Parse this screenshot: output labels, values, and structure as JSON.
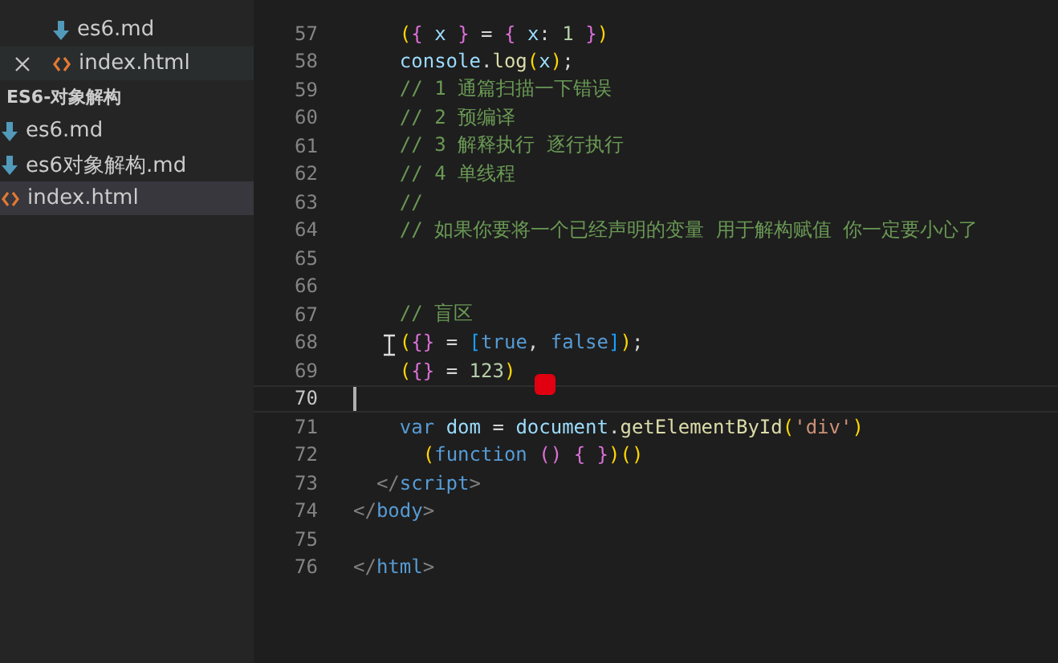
{
  "sidebar": {
    "open_editors": [
      {
        "name": "es6.md",
        "kind": "md",
        "hovered": false,
        "selected": false
      },
      {
        "name": "index.html",
        "kind": "html",
        "hovered": true,
        "selected": false
      }
    ],
    "folder": {
      "title": "ES6-对象解构",
      "items": [
        {
          "name": "es6.md",
          "kind": "md",
          "selected": false
        },
        {
          "name": "es6对象解构.md",
          "kind": "md",
          "selected": false
        },
        {
          "name": "index.html",
          "kind": "html",
          "selected": true
        }
      ]
    }
  },
  "editor": {
    "lines": [
      {
        "number": "57",
        "current": false,
        "tokens": [
          {
            "text": "    (",
            "kind": "b1"
          },
          {
            "text": "{",
            "kind": "b2"
          },
          {
            "text": " x ",
            "kind": "var"
          },
          {
            "text": "}",
            "kind": "b2"
          },
          {
            "text": " = ",
            "kind": "plain"
          },
          {
            "text": "{",
            "kind": "b2"
          },
          {
            "text": " x",
            "kind": "var"
          },
          {
            "text": ": ",
            "kind": "plain"
          },
          {
            "text": "1 ",
            "kind": "num"
          },
          {
            "text": "}",
            "kind": "b2"
          },
          {
            "text": ")",
            "kind": "b1"
          }
        ]
      },
      {
        "number": "58",
        "current": false,
        "tokens": [
          {
            "text": "    console",
            "kind": "var"
          },
          {
            "text": ".",
            "kind": "plain"
          },
          {
            "text": "log",
            "kind": "fn"
          },
          {
            "text": "(",
            "kind": "b1"
          },
          {
            "text": "x",
            "kind": "var"
          },
          {
            "text": ")",
            "kind": "b1"
          },
          {
            "text": ";",
            "kind": "plain"
          }
        ]
      },
      {
        "number": "59",
        "current": false,
        "tokens": [
          {
            "text": "    // 1 通篇扫描一下错误",
            "kind": "comment"
          }
        ]
      },
      {
        "number": "60",
        "current": false,
        "tokens": [
          {
            "text": "    // 2 预编译",
            "kind": "comment"
          }
        ]
      },
      {
        "number": "61",
        "current": false,
        "tokens": [
          {
            "text": "    // 3 解释执行 逐行执行",
            "kind": "comment"
          }
        ]
      },
      {
        "number": "62",
        "current": false,
        "tokens": [
          {
            "text": "    // 4 单线程",
            "kind": "comment"
          }
        ]
      },
      {
        "number": "63",
        "current": false,
        "tokens": [
          {
            "text": "    //",
            "kind": "comment"
          }
        ]
      },
      {
        "number": "64",
        "current": false,
        "tokens": [
          {
            "text": "    // 如果你要将一个已经声明的变量 用于解构赋值 你一定要小心了",
            "kind": "comment"
          }
        ]
      },
      {
        "number": "65",
        "current": false
      },
      {
        "number": "66",
        "current": false
      },
      {
        "number": "67",
        "current": false,
        "tokens": [
          {
            "text": "    // 盲区",
            "kind": "comment"
          }
        ]
      },
      {
        "number": "68",
        "current": false,
        "tokens": [
          {
            "text": "    (",
            "kind": "b1"
          },
          {
            "text": "{}",
            "kind": "b2"
          },
          {
            "text": " = ",
            "kind": "plain"
          },
          {
            "text": "[",
            "kind": "b3"
          },
          {
            "text": "true",
            "kind": "kw"
          },
          {
            "text": ", ",
            "kind": "plain"
          },
          {
            "text": "false",
            "kind": "kw"
          },
          {
            "text": "]",
            "kind": "b3"
          },
          {
            "text": ")",
            "kind": "b1"
          },
          {
            "text": ";",
            "kind": "plain"
          }
        ]
      },
      {
        "number": "69",
        "current": false,
        "tokens": [
          {
            "text": "    (",
            "kind": "b1"
          },
          {
            "text": "{}",
            "kind": "b2"
          },
          {
            "text": " = ",
            "kind": "plain"
          },
          {
            "text": "123",
            "kind": "num"
          },
          {
            "text": ")",
            "kind": "b1"
          }
        ]
      },
      {
        "number": "70",
        "current": true
      },
      {
        "number": "71",
        "current": false,
        "tokens": [
          {
            "text": "    var",
            "kind": "kw"
          },
          {
            "text": " dom",
            "kind": "var"
          },
          {
            "text": " = ",
            "kind": "plain"
          },
          {
            "text": "document",
            "kind": "var"
          },
          {
            "text": ".",
            "kind": "plain"
          },
          {
            "text": "getElementById",
            "kind": "fn"
          },
          {
            "text": "(",
            "kind": "b1"
          },
          {
            "text": "'div'",
            "kind": "str"
          },
          {
            "text": ")",
            "kind": "b1"
          }
        ]
      },
      {
        "number": "72",
        "current": false,
        "tokens": [
          {
            "text": "      (",
            "kind": "b1"
          },
          {
            "text": "function ",
            "kind": "kw"
          },
          {
            "text": "() ",
            "kind": "b2"
          },
          {
            "text": "{ ",
            "kind": "b2"
          },
          {
            "text": "}",
            "kind": "b2"
          },
          {
            "text": ")",
            "kind": "b1"
          },
          {
            "text": "()",
            "kind": "b1"
          }
        ]
      },
      {
        "number": "73",
        "current": false,
        "tokens": [
          {
            "text": "  </",
            "kind": "punc"
          },
          {
            "text": "script",
            "kind": "tag"
          },
          {
            "text": ">",
            "kind": "punc"
          }
        ]
      },
      {
        "number": "74",
        "current": false,
        "tokens": [
          {
            "text": "</",
            "kind": "punc"
          },
          {
            "text": "body",
            "kind": "tag"
          },
          {
            "text": ">",
            "kind": "punc"
          }
        ]
      },
      {
        "number": "75",
        "current": false
      },
      {
        "number": "76",
        "current": false,
        "tokens": [
          {
            "text": "</",
            "kind": "punc"
          },
          {
            "text": "html",
            "kind": "tag"
          },
          {
            "text": ">",
            "kind": "punc"
          }
        ]
      }
    ]
  }
}
